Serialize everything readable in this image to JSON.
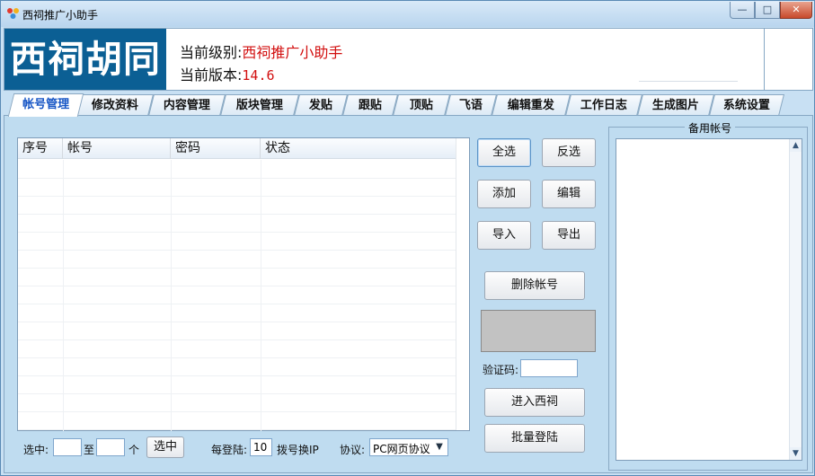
{
  "window": {
    "title": "西祠推广小助手",
    "min_glyph": "—",
    "max_glyph": "□",
    "close_glyph": "✕"
  },
  "banner": {
    "logo_text": "西祠胡同",
    "level_label": "当前级别:",
    "level_value": "西祠推广小助手",
    "version_label": "当前版本:",
    "version_value": "14.6"
  },
  "tabs": [
    {
      "label": "帐号管理",
      "active": true
    },
    {
      "label": "修改资料"
    },
    {
      "label": "内容管理"
    },
    {
      "label": "版块管理"
    },
    {
      "label": "发贴"
    },
    {
      "label": "跟贴"
    },
    {
      "label": "顶贴"
    },
    {
      "label": "飞语"
    },
    {
      "label": "编辑重发"
    },
    {
      "label": "工作日志"
    },
    {
      "label": "生成图片"
    },
    {
      "label": "系统设置"
    }
  ],
  "account_table": {
    "columns": [
      "序号",
      "帐号",
      "密码",
      "状态"
    ],
    "rows": []
  },
  "buttons": {
    "select_all": "全选",
    "invert": "反选",
    "add": "添加",
    "edit": "编辑",
    "import": "导入",
    "export": "导出",
    "delete_account": "删除帐号",
    "enter_xici": "进入西祠",
    "batch_login": "批量登陆",
    "select": "选中"
  },
  "captcha": {
    "label": "验证码:",
    "value": ""
  },
  "bottom_bar": {
    "select_label": "选中:",
    "from_value": "",
    "to_label": "至",
    "to_value": "",
    "unit": "个",
    "per_login_label": "每登陆:",
    "per_login_value": "10",
    "dial_label": "拨号换IP",
    "protocol_label": "协议:",
    "protocol_value": "PC网页协议"
  },
  "backup": {
    "title": "备用帐号"
  },
  "colors": {
    "logo_bg": "#0b5f94",
    "value_red": "#d20f0f",
    "active_tab_text": "#1655c5",
    "panel_bg": "#bfdcf0"
  }
}
